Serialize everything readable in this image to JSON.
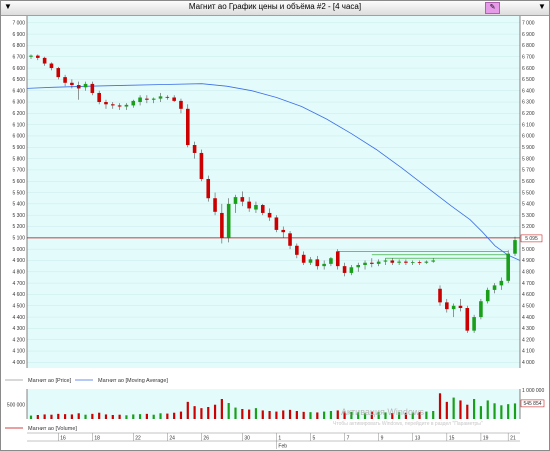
{
  "window": {
    "title": "Магнит ао График цены и объёма #2 - [4 часа]",
    "pin_icon": "pin-icon",
    "left_marker": "▼",
    "right_marker": "▼"
  },
  "chart_data": [
    {
      "type": "candlestick",
      "name": "price",
      "y_ticks": [
        "7 000",
        "6 900",
        "6 800",
        "6 700",
        "6 600",
        "6 500",
        "6 400",
        "6 300",
        "6 200",
        "6 100",
        "6 000",
        "5 900",
        "5 800",
        "5 700",
        "5 600",
        "5 500",
        "5 400",
        "5 300",
        "5 200",
        "5 100",
        "5 000",
        "4 900",
        "4 800",
        "4 700",
        "4 600",
        "4 500",
        "4 400",
        "4 300",
        "4 200",
        "4 100",
        "4 000"
      ],
      "ylim": [
        3950,
        7060
      ],
      "x_labels": [
        "16",
        "18",
        "22",
        "24",
        "26",
        "30",
        "1",
        "5",
        "7",
        "9",
        "13",
        "15",
        "19",
        "21"
      ],
      "month_label": "Feb",
      "candles": [
        [
          6700,
          6720,
          6680,
          6710
        ],
        [
          6710,
          6720,
          6670,
          6690
        ],
        [
          6690,
          6700,
          6620,
          6640
        ],
        [
          6640,
          6650,
          6580,
          6600
        ],
        [
          6600,
          6610,
          6500,
          6520
        ],
        [
          6520,
          6540,
          6440,
          6470
        ],
        [
          6470,
          6500,
          6420,
          6450
        ],
        [
          6450,
          6480,
          6320,
          6420
        ],
        [
          6430,
          6480,
          6400,
          6460
        ],
        [
          6460,
          6480,
          6360,
          6380
        ],
        [
          6380,
          6400,
          6280,
          6300
        ],
        [
          6300,
          6320,
          6240,
          6280
        ],
        [
          6280,
          6300,
          6240,
          6270
        ],
        [
          6270,
          6290,
          6230,
          6260
        ],
        [
          6260,
          6290,
          6230,
          6275
        ],
        [
          6270,
          6320,
          6250,
          6310
        ],
        [
          6300,
          6360,
          6270,
          6340
        ],
        [
          6330,
          6360,
          6290,
          6320
        ],
        [
          6320,
          6340,
          6290,
          6330
        ],
        [
          6330,
          6380,
          6300,
          6350
        ],
        [
          6345,
          6360,
          6320,
          6340
        ],
        [
          6340,
          6360,
          6300,
          6310
        ],
        [
          6310,
          6330,
          6200,
          6240
        ],
        [
          6240,
          6280,
          5900,
          5920
        ],
        [
          5920,
          5950,
          5800,
          5850
        ],
        [
          5850,
          5880,
          5600,
          5620
        ],
        [
          5620,
          5650,
          5420,
          5450
        ],
        [
          5450,
          5500,
          5300,
          5330
        ],
        [
          5320,
          5400,
          5050,
          5100
        ],
        [
          5100,
          5450,
          5060,
          5400
        ],
        [
          5400,
          5480,
          5320,
          5460
        ],
        [
          5460,
          5510,
          5380,
          5420
        ],
        [
          5420,
          5460,
          5330,
          5360
        ],
        [
          5350,
          5420,
          5320,
          5390
        ],
        [
          5390,
          5400,
          5300,
          5320
        ],
        [
          5320,
          5360,
          5250,
          5280
        ],
        [
          5280,
          5300,
          5150,
          5170
        ],
        [
          5170,
          5200,
          5100,
          5150
        ],
        [
          5140,
          5160,
          5000,
          5030
        ],
        [
          5030,
          5050,
          4920,
          4950
        ],
        [
          4950,
          4980,
          4860,
          4880
        ],
        [
          4880,
          4930,
          4860,
          4910
        ],
        [
          4910,
          4940,
          4820,
          4850
        ],
        [
          4850,
          4900,
          4820,
          4870
        ],
        [
          4870,
          4930,
          4850,
          4920
        ],
        [
          4980,
          5000,
          4820,
          4850
        ],
        [
          4850,
          4880,
          4760,
          4790
        ],
        [
          4790,
          4860,
          4770,
          4840
        ],
        [
          4840,
          4880,
          4800,
          4860
        ],
        [
          4860,
          4900,
          4820,
          4880
        ],
        [
          4880,
          4920,
          4840,
          4870
        ],
        [
          4870,
          4910,
          4850,
          4890
        ],
        [
          4890,
          4920,
          4860,
          4900
        ],
        [
          4900,
          4920,
          4860,
          4880
        ],
        [
          4880,
          4910,
          4860,
          4890
        ],
        [
          4890,
          4910,
          4860,
          4880
        ],
        [
          4880,
          4900,
          4860,
          4885
        ],
        [
          4885,
          4900,
          4860,
          4880
        ],
        [
          4880,
          4900,
          4870,
          4890
        ],
        [
          4890,
          4920,
          4880,
          4900
        ],
        [
          4650,
          4680,
          4500,
          4530
        ],
        [
          4530,
          4560,
          4440,
          4470
        ],
        [
          4470,
          4520,
          4400,
          4500
        ],
        [
          4500,
          4560,
          4450,
          4480
        ],
        [
          4480,
          4500,
          4260,
          4280
        ],
        [
          4280,
          4420,
          4260,
          4400
        ],
        [
          4400,
          4560,
          4380,
          4540
        ],
        [
          4540,
          4660,
          4520,
          4640
        ],
        [
          4640,
          4700,
          4610,
          4680
        ],
        [
          4680,
          4750,
          4640,
          4720
        ],
        [
          4720,
          4990,
          4700,
          4960
        ],
        [
          4960,
          5110,
          4940,
          5080
        ]
      ],
      "bull_color": "#1a9f1a",
      "bear_color": "#cc0000",
      "moving_average": [
        [
          0,
          6420
        ],
        [
          4,
          6430
        ],
        [
          10,
          6440
        ],
        [
          16,
          6448
        ],
        [
          22,
          6455
        ],
        [
          28,
          6462
        ],
        [
          32,
          6440
        ],
        [
          36,
          6400
        ],
        [
          40,
          6340
        ],
        [
          44,
          6260
        ],
        [
          48,
          6150
        ],
        [
          52,
          6020
        ],
        [
          56,
          5880
        ],
        [
          60,
          5720
        ],
        [
          64,
          5550
        ],
        [
          68,
          5380
        ],
        [
          71,
          5260
        ],
        [
          73,
          5150
        ],
        [
          75,
          5030
        ],
        [
          77,
          4950
        ],
        [
          79,
          4900
        ]
      ],
      "ma_color": "#3a6ee8",
      "horizontal_line_red": 5100,
      "green_lines": [
        4980,
        4950,
        4920
      ],
      "last_price_label": "5 095",
      "legend": [
        "Магнит ао [Price]",
        "Магнит ао [Moving Average]"
      ]
    },
    {
      "type": "bar",
      "name": "volume",
      "y_ticks_left": [
        "500 000"
      ],
      "y_ticks_right": [
        "1 000 000"
      ],
      "last_volume_label": "545 854",
      "volumes": [
        120000,
        140000,
        160000,
        150000,
        180000,
        170000,
        160000,
        200000,
        150000,
        180000,
        220000,
        160000,
        140000,
        150000,
        130000,
        160000,
        170000,
        180000,
        150000,
        200000,
        190000,
        220000,
        260000,
        600000,
        450000,
        380000,
        420000,
        500000,
        700000,
        560000,
        400000,
        350000,
        330000,
        380000,
        300000,
        280000,
        260000,
        300000,
        320000,
        280000,
        250000,
        240000,
        230000,
        260000,
        280000,
        300000,
        260000,
        250000,
        240000,
        220000,
        260000,
        250000,
        230000,
        210000,
        240000,
        220000,
        230000,
        240000,
        260000,
        280000,
        900000,
        600000,
        750000,
        650000,
        500000,
        700000,
        450000,
        650000,
        550000,
        480000,
        520000,
        545854
      ],
      "legend": [
        "Магнит ао [Volume]"
      ]
    }
  ],
  "watermark": {
    "line1": "Активация Windows",
    "line2": "Чтобы активировать Windows, перейдите в раздел \"Параметры\""
  }
}
